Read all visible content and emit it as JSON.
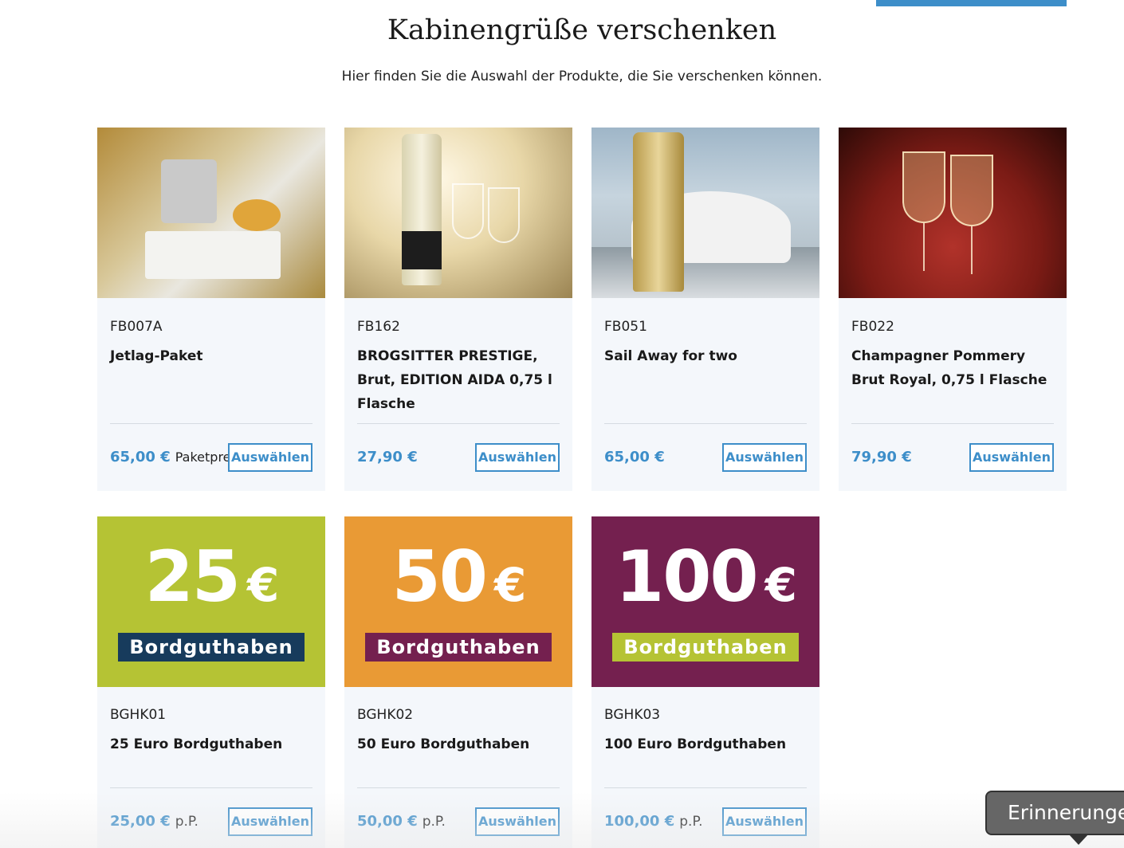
{
  "page": {
    "title": "Kabinengrüße verschenken",
    "subtitle": "Hier finden Sie die Auswahl der Produkte, die Sie verschenken können."
  },
  "colors": {
    "accent": "#3d8ec9",
    "card_bg": "#f4f7fb",
    "voucher_green": "#b5c334",
    "voucher_orange": "#e99a35",
    "voucher_purple": "#74204f",
    "tag_navy": "#173b5c"
  },
  "products": [
    {
      "code": "FB007A",
      "name": "Jetlag-Paket",
      "price": "65,00 €",
      "unit": "Paketpreis",
      "button": "Auswählen",
      "image": "room-service-tray-photo"
    },
    {
      "code": "FB162",
      "name": "BROGSITTER PRESTIGE, Brut, EDITION AIDA 0,75 l Flasche",
      "price": "27,90 €",
      "unit": "",
      "button": "Auswählen",
      "image": "sparkling-wine-bottle-photo"
    },
    {
      "code": "FB051",
      "name": "Sail Away for two",
      "price": "65,00 €",
      "unit": "",
      "button": "Auswählen",
      "image": "champagne-bucket-photo"
    },
    {
      "code": "FB022",
      "name": "Champagner Pommery Brut Royal, 0,75 l Flasche",
      "price": "79,90 €",
      "unit": "",
      "button": "Auswählen",
      "image": "champagne-glasses-photo"
    },
    {
      "code": "BGHK01",
      "name": "25 Euro Bordguthaben",
      "price": "25,00 €",
      "unit": "p.P.",
      "button": "Auswählen",
      "voucher": {
        "amount": "25",
        "currency": "€",
        "label": "Bordguthaben"
      }
    },
    {
      "code": "BGHK02",
      "name": "50 Euro Bordguthaben",
      "price": "50,00 €",
      "unit": "p.P.",
      "button": "Auswählen",
      "voucher": {
        "amount": "50",
        "currency": "€",
        "label": "Bordguthaben"
      }
    },
    {
      "code": "BGHK03",
      "name": "100 Euro Bordguthaben",
      "price": "100,00 €",
      "unit": "p.P.",
      "button": "Auswählen",
      "voucher": {
        "amount": "100",
        "currency": "€",
        "label": "Bordguthaben"
      }
    }
  ],
  "reminder": {
    "label": "Erinnerunge"
  }
}
